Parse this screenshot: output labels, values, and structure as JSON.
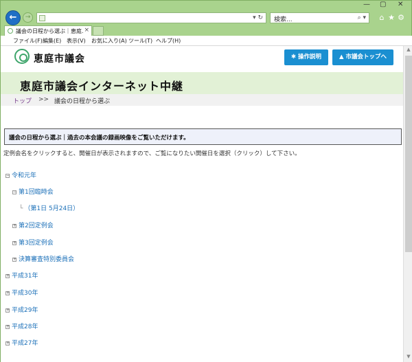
{
  "browser": {
    "search_placeholder": "検索...",
    "url_controls": "▾ ↻",
    "search_icon": "⌕ ▾",
    "tab_title": "議会の日程から選ぶ｜恵庭...",
    "tab_close": "×",
    "toolbar_icons": [
      "home-icon",
      "star-icon",
      "gear-icon"
    ],
    "window_controls": [
      "minimize-icon",
      "maximize-icon",
      "close-icon"
    ]
  },
  "menubar": [
    "ファイル(F)",
    "編集(E)",
    "表示(V)",
    "お気に入り(A)",
    "ツール(T)",
    "ヘルプ(H)"
  ],
  "site": {
    "logo_text": "恵庭市議会",
    "btn_help": "操作説明",
    "btn_top": "市議会トップへ",
    "title": "恵庭市議会インターネット中継"
  },
  "breadcrumb": {
    "top": "トップ",
    "sep": ">>",
    "current": "議会の日程から選ぶ"
  },
  "section": {
    "text": "議会の日程から選ぶ｜過去の本会議の録画映像をご覧いただけます。",
    "instruction": "定例会名をクリックすると、開催日が表示されますので、ご覧になりたい開催日を選択（クリック）して下さい。"
  },
  "tree": [
    {
      "label": "令和元年",
      "toggle": "−"
    },
    {
      "label": "第1回臨時会",
      "toggle": "−"
    },
    {
      "label": "（第1日 5月24日）",
      "toggle": ""
    },
    {
      "label": "第2回定例会",
      "toggle": "+"
    },
    {
      "label": "第3回定例会",
      "toggle": "+"
    },
    {
      "label": "決算審査特別委員会",
      "toggle": "+"
    },
    {
      "label": "平成31年",
      "toggle": "+"
    },
    {
      "label": "平成30年",
      "toggle": "+"
    },
    {
      "label": "平成29年",
      "toggle": "+"
    },
    {
      "label": "平成28年",
      "toggle": "+"
    },
    {
      "label": "平成27年",
      "toggle": "+"
    }
  ]
}
